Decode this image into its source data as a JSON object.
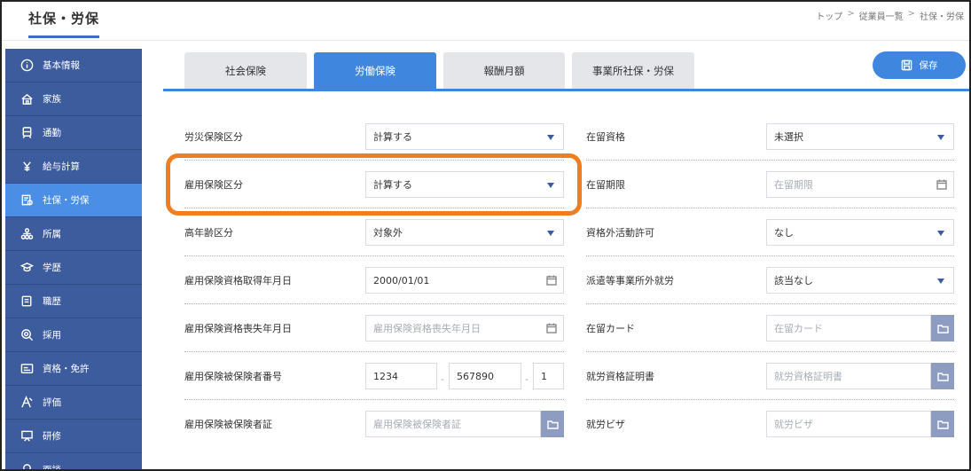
{
  "header": {
    "title": "社保・労保",
    "breadcrumb": [
      "トップ",
      "従業員一覧",
      "社保・労保"
    ],
    "breadcrumb_sep": ">"
  },
  "sidebar": {
    "items": [
      {
        "label": "基本情報",
        "icon": "info-icon"
      },
      {
        "label": "家族",
        "icon": "house-icon"
      },
      {
        "label": "通勤",
        "icon": "train-icon"
      },
      {
        "label": "給与計算",
        "icon": "money-icon"
      },
      {
        "label": "社保・労保",
        "icon": "insurance-icon",
        "active": true
      },
      {
        "label": "所属",
        "icon": "org-chart-icon"
      },
      {
        "label": "学歴",
        "icon": "graduation-cap-icon"
      },
      {
        "label": "職歴",
        "icon": "briefcase-icon"
      },
      {
        "label": "採用",
        "icon": "target-icon"
      },
      {
        "label": "資格・免許",
        "icon": "license-card-icon"
      },
      {
        "label": "評価",
        "icon": "rating-icon"
      },
      {
        "label": "研修",
        "icon": "training-icon"
      },
      {
        "label": "面談",
        "icon": "interview-icon"
      }
    ]
  },
  "tabs": [
    {
      "label": "社会保険"
    },
    {
      "label": "労働保険",
      "active": true
    },
    {
      "label": "報酬月額"
    },
    {
      "label": "事業所社保・労保"
    }
  ],
  "toolbar": {
    "save_label": "保存"
  },
  "left_form": {
    "workers_comp": {
      "label": "労災保険区分",
      "value": "計算する"
    },
    "employment_ins": {
      "label": "雇用保険区分",
      "value": "計算する"
    },
    "senior": {
      "label": "高年齢区分",
      "value": "対象外"
    },
    "acquired_date": {
      "label": "雇用保険資格取得年月日",
      "value": "2000/01/01"
    },
    "lost_date": {
      "label": "雇用保険資格喪失年月日",
      "placeholder": "雇用保険資格喪失年月日"
    },
    "insured_number": {
      "label": "雇用保険被保険者番号",
      "part1": "1234",
      "part2": "567890",
      "part3": "1",
      "sep": "-"
    },
    "insured_cert": {
      "label": "雇用保険被保険者証",
      "placeholder": "雇用保険被保険者証"
    }
  },
  "right_form": {
    "residence_status": {
      "label": "在留資格",
      "value": "未選択"
    },
    "residence_period": {
      "label": "在留期限",
      "placeholder": "在留期限"
    },
    "extra_activity": {
      "label": "資格外活動許可",
      "value": "なし"
    },
    "dispatch": {
      "label": "派遣等事業所外就労",
      "value": "該当なし"
    },
    "residence_card": {
      "label": "在留カード",
      "placeholder": "在留カード"
    },
    "work_cert": {
      "label": "就労資格証明書",
      "placeholder": "就労資格証明書"
    },
    "work_visa": {
      "label": "就労ビザ",
      "placeholder": "就労ビザ"
    }
  },
  "colors": {
    "accent": "#3f86df",
    "sidebar": "#3d5c9e",
    "highlight": "#ef7d21"
  }
}
